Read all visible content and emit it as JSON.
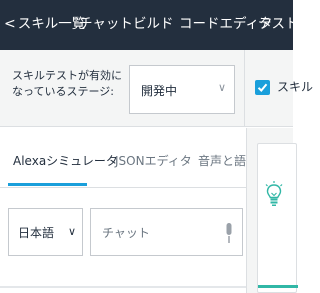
{
  "nav": {
    "back_label": "スキル一覧",
    "chat": "チャット",
    "build": "ビルド",
    "code_editor": "コードエディタ",
    "test": "テスト"
  },
  "stage": {
    "label": "スキルテストが有効になっているステージ:",
    "selected": "開発中",
    "checkbox_label": "スキル"
  },
  "tabs": {
    "simulator": "Alexaシミュレータ",
    "json_editor": "JSONエディタ",
    "voice": "音声と語調"
  },
  "input": {
    "language": "日本語",
    "placeholder": "チャット"
  },
  "icons": {
    "back": "chevron-left-icon",
    "select": "chevron-down-icon",
    "mic": "microphone-icon",
    "bulb": "lightbulb-icon",
    "check": "check-icon"
  },
  "colors": {
    "nav_bg": "#232f3e",
    "accent": "#1a9fdb",
    "bulb": "#31b7a6"
  }
}
